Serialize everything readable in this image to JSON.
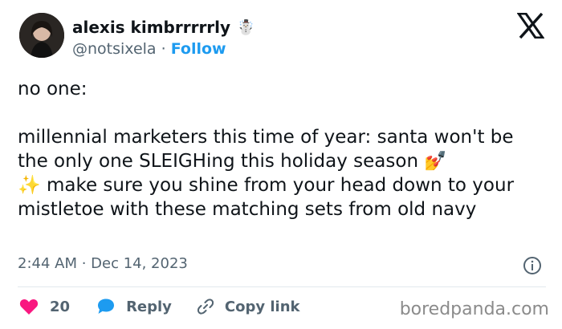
{
  "author": {
    "display_name": "alexis kimbrrrrrly",
    "handle": "@notsixela",
    "separator": "·",
    "follow_label": "Follow",
    "badge_emoji": "☃️"
  },
  "tweet": {
    "text": "no one:\n\nmillennial marketers this time of year: santa won't be the only one SLEIGHing this holiday season 💅\n✨ make sure you shine from your head down to your mistletoe with these matching sets from old navy"
  },
  "meta": {
    "timestamp": "2:44 AM · Dec 14, 2023"
  },
  "actions": {
    "like_count": "20",
    "reply_label": "Reply",
    "copy_link_label": "Copy link"
  },
  "watermark": "boredpanda.com",
  "colors": {
    "accent": "#1d9bf0",
    "like": "#f91880",
    "text": "#0f1419",
    "muted": "#536471"
  },
  "icons": [
    "x-logo-icon",
    "info-icon",
    "heart-icon",
    "reply-bubble-icon",
    "link-icon"
  ]
}
